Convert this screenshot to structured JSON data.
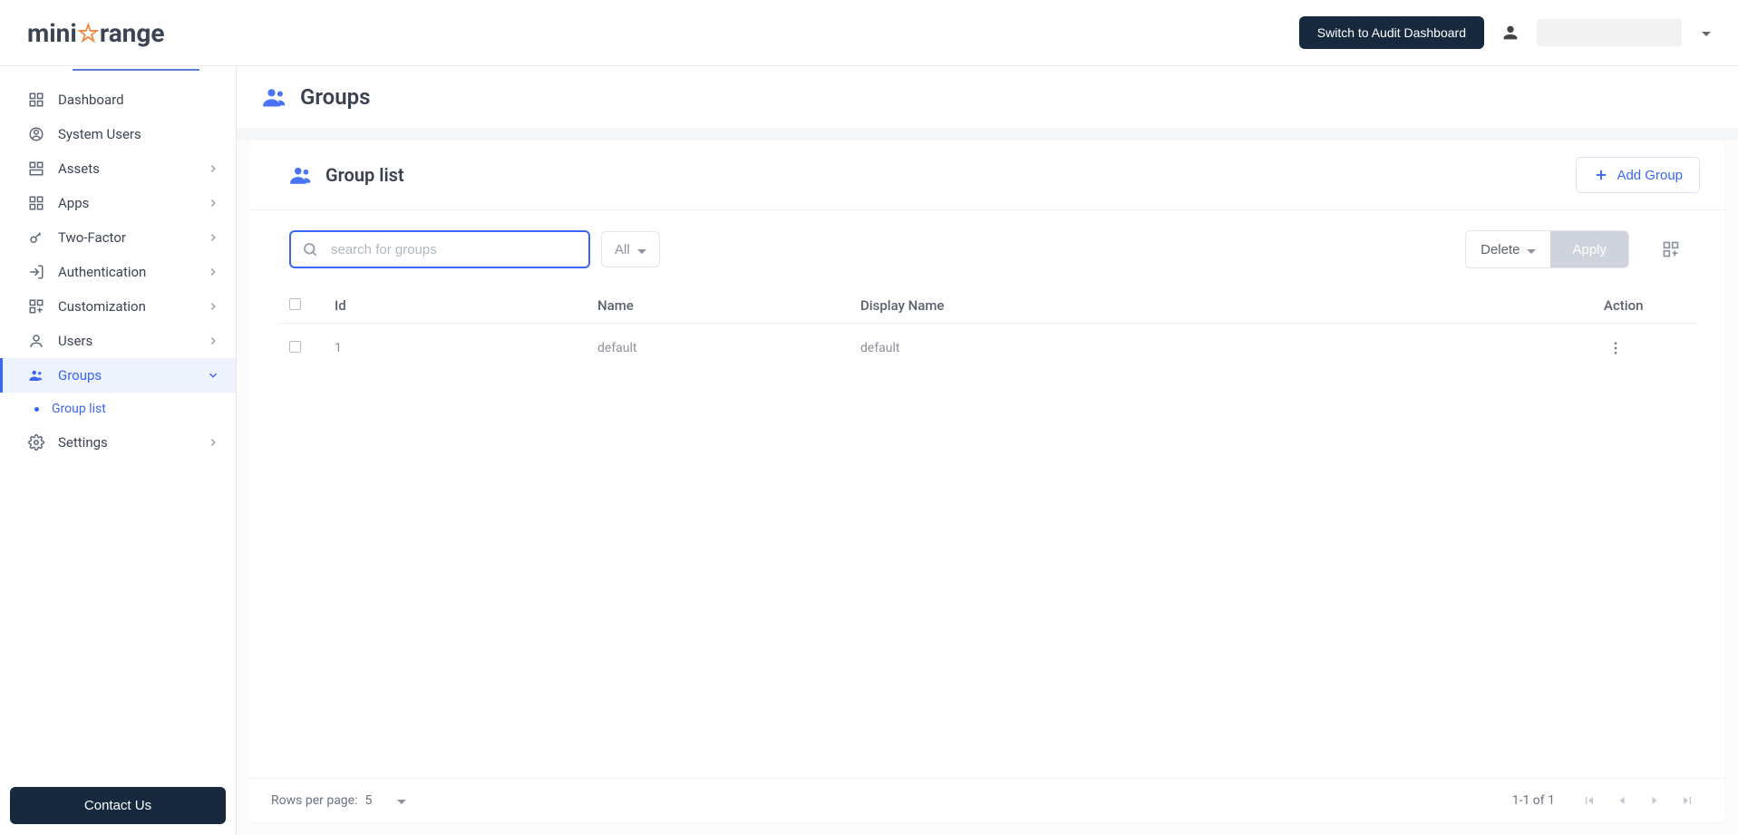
{
  "header": {
    "switch_button": "Switch to Audit Dashboard"
  },
  "sidebar": {
    "items": [
      {
        "label": "Dashboard"
      },
      {
        "label": "System Users"
      },
      {
        "label": "Assets"
      },
      {
        "label": "Apps"
      },
      {
        "label": "Two-Factor"
      },
      {
        "label": "Authentication"
      },
      {
        "label": "Customization"
      },
      {
        "label": "Users"
      },
      {
        "label": "Groups"
      },
      {
        "label": "Settings"
      }
    ],
    "sub_group_list": "Group list",
    "contact_us": "Contact Us"
  },
  "page": {
    "title": "Groups"
  },
  "card": {
    "title": "Group list",
    "add_button": "Add Group",
    "search_placeholder": "search for groups",
    "filter_all": "All",
    "delete_label": "Delete",
    "apply_label": "Apply"
  },
  "table": {
    "headers": {
      "id": "Id",
      "name": "Name",
      "display_name": "Display Name",
      "action": "Action"
    },
    "rows": [
      {
        "id": "1",
        "name": "default",
        "display_name": "default"
      }
    ]
  },
  "pagination": {
    "rows_label": "Rows per page:",
    "page_size": "5",
    "range": "1-1 of 1"
  }
}
